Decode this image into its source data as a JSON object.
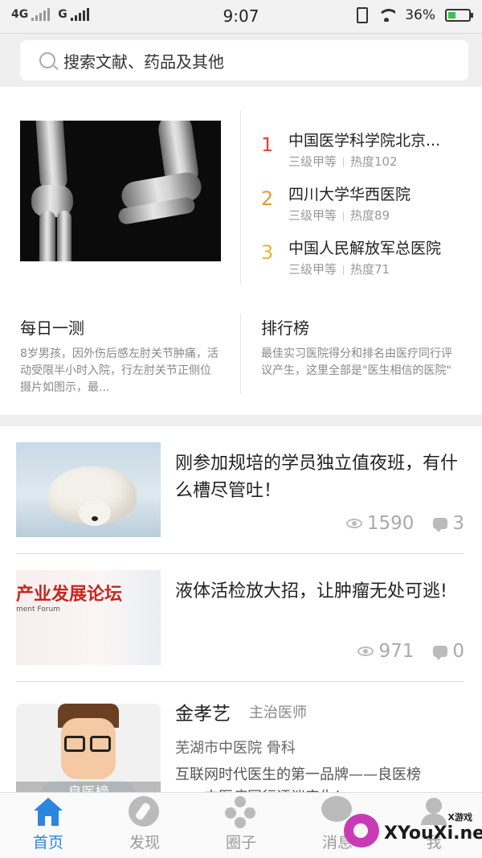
{
  "status_bar": {
    "network_1": "4G",
    "network_2": "G",
    "time": "9:07",
    "battery": "36%",
    "battery_level": 0.36
  },
  "search": {
    "placeholder": "搜索文献、药品及其他"
  },
  "hospital_ranking": [
    {
      "rank": "1",
      "name": "中国医学科学院北京...",
      "level": "三级甲等",
      "heat": "热度102",
      "color": "#e0443b"
    },
    {
      "rank": "2",
      "name": "四川大学华西医院",
      "level": "三级甲等",
      "heat": "热度89",
      "color": "#e8963a"
    },
    {
      "rank": "3",
      "name": "中国人民解放军总医院",
      "level": "三级甲等",
      "heat": "热度71",
      "color": "#e8b53a"
    }
  ],
  "daily_quiz": {
    "title": "每日一测",
    "desc": "8岁男孩，因外伤后感左肘关节肿痛，活动受限半小时入院，行左肘关节正侧位摄片如图示，最..."
  },
  "leaderboard": {
    "title": "排行榜",
    "desc": "最佳实习医院得分和排名由医疗同行评议产生，这里全部是\"医生相信的医院\""
  },
  "articles": [
    {
      "title": "刚参加规培的学员独立值夜班，有什么槽尽管吐！",
      "views": "1590",
      "comments": "3"
    },
    {
      "title": "液体活检放大招，让肿瘤无处可逃!",
      "views": "971",
      "comments": "0",
      "image_text": "产业发展论坛",
      "image_subtext": "ment Forum"
    }
  ],
  "doctor": {
    "name": "金孝艺",
    "title": "主治医师",
    "hospital": "芜湖市中医院  骨科",
    "intro": "互联网时代医生的第一品牌——良医榜——中医病同行评议产生！",
    "badge": "良医榜"
  },
  "tabs": [
    {
      "label": "首页",
      "icon": "home-icon",
      "active": true
    },
    {
      "label": "发现",
      "icon": "compass-icon"
    },
    {
      "label": "圈子",
      "icon": "circle-network-icon"
    },
    {
      "label": "消息",
      "icon": "message-icon"
    },
    {
      "label": "我",
      "icon": "profile-icon"
    }
  ],
  "watermark": {
    "small": "X游戏",
    "text": "XYouXi.net"
  },
  "colors": {
    "accent": "#2a86de",
    "inactive": "#999999"
  }
}
